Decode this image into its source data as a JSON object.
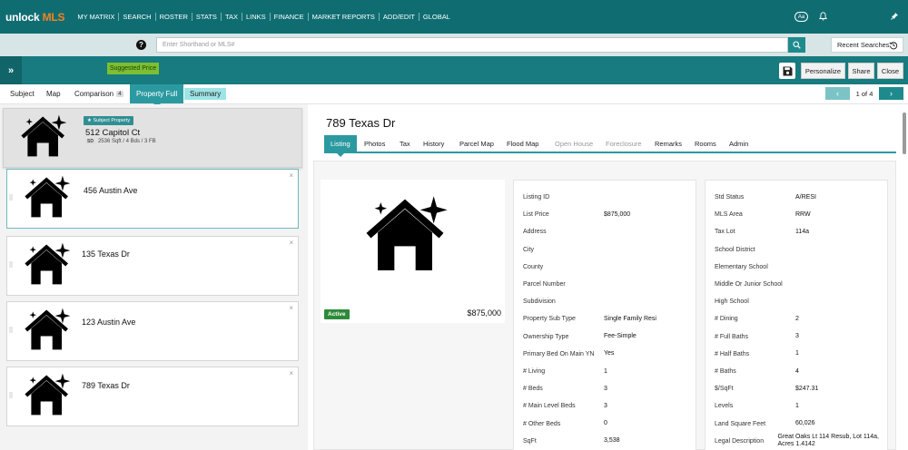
{
  "brand": {
    "name_part1": "unlock",
    "name_part2": "MLS"
  },
  "nav": [
    "MY MATRIX",
    "SEARCH",
    "ROSTER",
    "STATS",
    "TAX",
    "LINKS",
    "FINANCE",
    "MARKET REPORTS",
    "ADD/EDIT",
    "GLOBAL"
  ],
  "top_right": {
    "text_size_label": "Aa"
  },
  "search": {
    "placeholder": "Enter Shorthand or MLS#",
    "recent_label": "Recent Searches"
  },
  "toolbar": {
    "suggested_label": "Suggested Price",
    "personalize_label": "Personalize",
    "share_label": "Share",
    "close_label": "Close"
  },
  "subtabs": {
    "subject": "Subject",
    "map": "Map",
    "comparison": "Comparison",
    "comparison_count": "4",
    "property_full": "Property Full",
    "summary": "Summary"
  },
  "pager": {
    "text": "1 of 4"
  },
  "subject_card": {
    "badge": "Subject Property",
    "address": "512 Capitol Ct",
    "sd_tag": "SD",
    "details": "2536 Sqft / 4 Bds / 3 FB"
  },
  "comps": [
    {
      "address": "456 Austin Ave"
    },
    {
      "address": "135 Texas Dr"
    },
    {
      "address": "123 Austin Ave"
    },
    {
      "address": "789 Texas Dr"
    }
  ],
  "property": {
    "title": "789 Texas Dr",
    "tabs": [
      "Listing",
      "Photos",
      "Tax",
      "History",
      "Parcel Map",
      "Flood Map",
      "Open House",
      "Foreclosure",
      "Remarks",
      "Rooms",
      "Admin"
    ],
    "status": "Active",
    "price": "$875,000",
    "left_fields": [
      {
        "label": "Listing ID",
        "value": ""
      },
      {
        "label": "List Price",
        "value": "$875,000"
      },
      {
        "label": "Address",
        "value": ""
      },
      {
        "label": "City",
        "value": ""
      },
      {
        "label": "County",
        "value": ""
      },
      {
        "label": "Parcel Number",
        "value": ""
      },
      {
        "label": "Subdivision",
        "value": ""
      },
      {
        "label": "Property Sub Type",
        "value": "Single Family Resi"
      },
      {
        "label": "Ownership Type",
        "value": "Fee-Simple"
      },
      {
        "label": "Primary Bed On Main YN",
        "value": "Yes"
      },
      {
        "label": "# Living",
        "value": "1"
      },
      {
        "label": "# Beds",
        "value": "3"
      },
      {
        "label": "# Main Level Beds",
        "value": "3"
      },
      {
        "label": "# Other Beds",
        "value": "0"
      },
      {
        "label": "SqFt",
        "value": "3,538"
      }
    ],
    "right_fields": [
      {
        "label": "Std Status",
        "value": "A/RESI"
      },
      {
        "label": "MLS Area",
        "value": "RRW"
      },
      {
        "label": "Tax Lot",
        "value": "114a"
      },
      {
        "label": "School District",
        "value": ""
      },
      {
        "label": "Elementary School",
        "value": ""
      },
      {
        "label": "Middle Or Junior School",
        "value": ""
      },
      {
        "label": "High School",
        "value": ""
      },
      {
        "label": "# Dining",
        "value": "2"
      },
      {
        "label": "# Full Baths",
        "value": "3"
      },
      {
        "label": "# Half Baths",
        "value": "1"
      },
      {
        "label": "# Baths",
        "value": "4"
      },
      {
        "label": "$/SqFt",
        "value": "$247.31"
      },
      {
        "label": "Levels",
        "value": "1"
      },
      {
        "label": "Land Square Feet",
        "value": "60,026"
      },
      {
        "label": "Legal Description",
        "value": "Great Oaks Lt 114 Resub, Lot 114a, Acres 1.4142"
      }
    ]
  },
  "colors": {
    "brand_teal": "#0f6d72",
    "accent": "#2b9aa0",
    "logo_orange": "#f58220",
    "status_green": "#2d8a39",
    "suggested_green": "#7cbf31"
  }
}
